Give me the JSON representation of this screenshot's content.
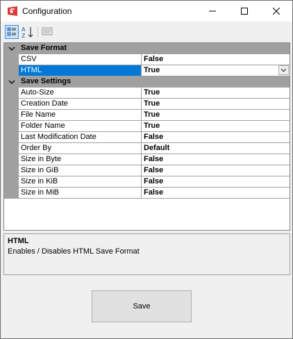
{
  "window": {
    "title": "Configuration",
    "buttons": [
      "minimize-icon",
      "maximize-icon",
      "close-icon"
    ]
  },
  "toolbar": {
    "buttons": [
      "categorized-icon",
      "alphabetical-icon",
      "property-pages-icon"
    ]
  },
  "grid": {
    "categories": [
      {
        "label": "Save Format",
        "properties": [
          {
            "name": "CSV",
            "value": "False"
          },
          {
            "name": "HTML",
            "value": "True"
          }
        ]
      },
      {
        "label": "Save Settings",
        "properties": [
          {
            "name": "Auto-Size",
            "value": "True"
          },
          {
            "name": "Creation Date",
            "value": "True"
          },
          {
            "name": "File Name",
            "value": "True"
          },
          {
            "name": "Folder Name",
            "value": "True"
          },
          {
            "name": "Last Modification Date",
            "value": "False"
          },
          {
            "name": "Order By",
            "value": "Default"
          },
          {
            "name": "Size in Byte",
            "value": "False"
          },
          {
            "name": "Size in GiB",
            "value": "False"
          },
          {
            "name": "Size in KiB",
            "value": "False"
          },
          {
            "name": "Size in MiB",
            "value": "False"
          }
        ]
      }
    ]
  },
  "help": {
    "title": "HTML",
    "description": "Enables / Disables HTML Save Format"
  },
  "save_button": {
    "label": "Save"
  },
  "colors": {
    "selection": "#0078d7",
    "category_bar": "#a0a0a0",
    "accent_icon": "#d83b3b"
  }
}
